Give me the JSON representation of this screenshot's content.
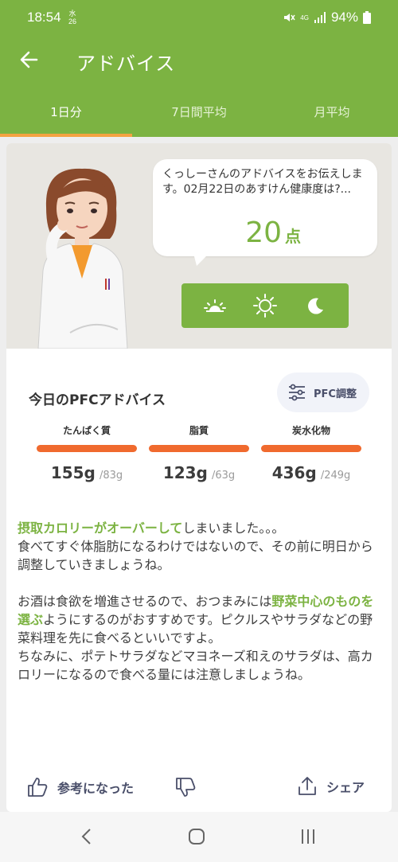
{
  "status_bar": {
    "time": "18:54",
    "date_top": "水",
    "date_bottom": "26",
    "network": "4G",
    "battery": "94%"
  },
  "app_bar": {
    "title": "アドバイス"
  },
  "tabs": [
    {
      "label": "1日分",
      "active": true
    },
    {
      "label": "7日間平均",
      "active": false
    },
    {
      "label": "月平均",
      "active": false
    }
  ],
  "speech": {
    "text": "くっしーさんのアドバイスをお伝えします。02月22日のあすけん健康度は?...",
    "score": "20",
    "score_unit": "点"
  },
  "time_of_day": [
    "sunrise-icon",
    "sun-icon",
    "moon-icon"
  ],
  "pfc": {
    "title": "今日のPFCアドバイス",
    "adjust_button": "PFC調整",
    "items": [
      {
        "label": "たんぱく質",
        "value": "155g",
        "target": "/83g"
      },
      {
        "label": "脂質",
        "value": "123g",
        "target": "/63g"
      },
      {
        "label": "炭水化物",
        "value": "436g",
        "target": "/249g"
      }
    ]
  },
  "advice": {
    "p1_hl": "摂取カロリーがオーバーして",
    "p1_rest": "しまいました。。。",
    "p1_line2": "食べてすぐ体脂肪になるわけではないので、その前に明日から調整していきましょうね。",
    "p2_pre": "お酒は食欲を増進させるので、おつまみには",
    "p2_hl": "野菜中心のものを選ぶ",
    "p2_post": "ようにするのがおすすめです。ピクルスやサラダなどの野菜料理を先に食べるといいですよ。",
    "p3": "ちなみに、ポテトサラダなどマヨネーズ和えのサラダは、高カロリーになるので食べる量には注意しましょうね。"
  },
  "actions": {
    "helpful": "参考になった",
    "share": "シェア"
  },
  "colors": {
    "brand_green": "#7cb342",
    "accent_orange": "#f4a341",
    "bar_orange": "#f06a2e"
  }
}
